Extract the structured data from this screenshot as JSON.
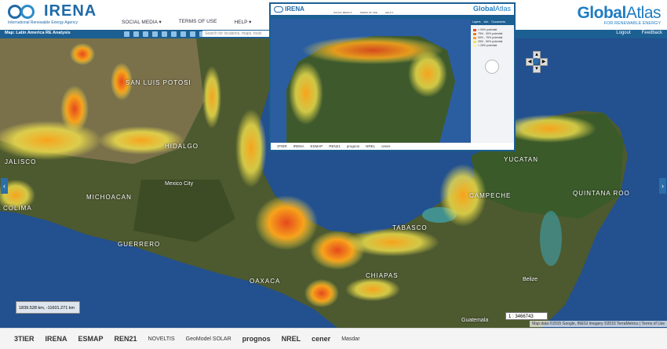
{
  "header": {
    "logo_text": "IRENA",
    "logo_subtitle": "International Renewable Energy Agency",
    "menu": [
      "SOCIAL MEDIA ▾",
      "TERMS OF USE",
      "HELP ▾"
    ],
    "brand_bold": "Global",
    "brand_light": "Atlas",
    "brand_subtitle": "FOR RENEWABLE ENERGY"
  },
  "toolbar": {
    "map_title": "Map: Latin America RE Analysis",
    "search_placeholder": "Search for locations, maps, tools",
    "logout": "Logout",
    "feedback": "Feedback"
  },
  "map": {
    "labels": [
      "SAN LUIS POTOSI",
      "HIDALGO",
      "JALISCO",
      "COLIMA",
      "MICHOACAN",
      "Mexico City",
      "GUERRERO",
      "OAXACA",
      "TABASCO",
      "CHIAPAS",
      "CAMPECHE",
      "YUCATAN",
      "QUINTANA ROO",
      "Belize",
      "Guatemala"
    ],
    "scale_text": "1839.528 km, -11601.271 km",
    "zoom_value": "1 : 3466743",
    "attribution": "Map data ©2015 Google, INEGI Imagery ©2015 TerraMetrics | Terms of Use"
  },
  "inset": {
    "menu": [
      "SOCIAL MEDIA ▾",
      "TERMS OF USE",
      "HELP ▾"
    ],
    "brand_bold": "Global",
    "brand_light": "Atlas",
    "panel_tabs": [
      "Layers",
      "Info",
      "Documents"
    ],
    "legend": [
      "> 90% potential",
      "75% - 90% potential",
      "50% - 75% potential",
      "25% - 50% potential",
      "< 25% potential"
    ],
    "footer": [
      "3TIER",
      "IRENA",
      "ESMAP",
      "REN21",
      "prognos",
      "NREL",
      "cener"
    ]
  },
  "footer_partners": [
    "3TIER",
    "IRENA",
    "ESMAP",
    "REN21",
    "NOVELTIS",
    "GeoModel SOLAR",
    "prognos",
    "NREL",
    "cener",
    "Masdar"
  ],
  "colors": {
    "brand_blue": "#1c5f93",
    "suitability_high": "#e5491c",
    "suitability_mid": "#f7a21b",
    "suitability_low": "#f3e34d"
  }
}
